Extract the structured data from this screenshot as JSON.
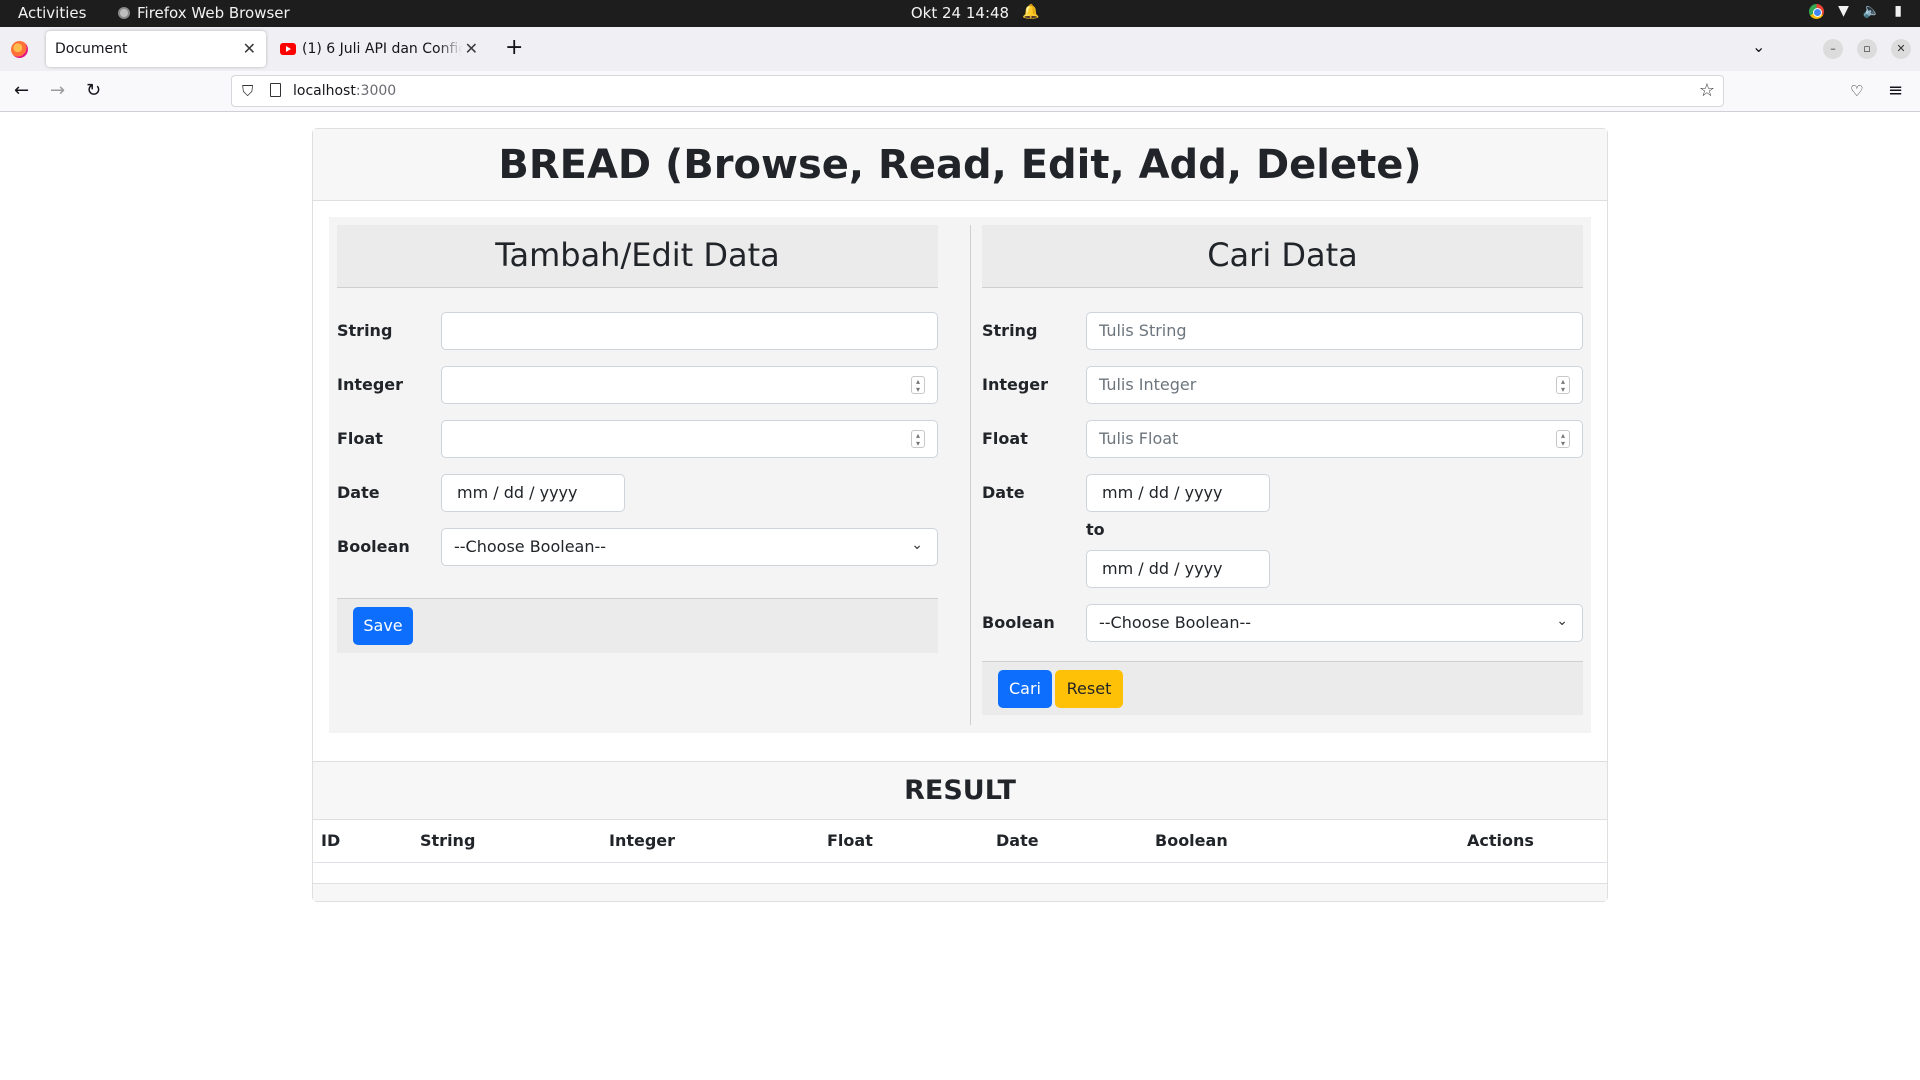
{
  "system": {
    "activities": "Activities",
    "app_name": "Firefox Web Browser",
    "clock": "Okt 24  14:48"
  },
  "browser": {
    "tabs": [
      {
        "title": "Document",
        "active": true
      },
      {
        "title": "(1) 6 Juli API dan Configuration",
        "active": false
      }
    ],
    "url_host": "localhost",
    "url_port": ":3000"
  },
  "page": {
    "title": "BREAD (Browse, Read, Edit, Add, Delete)",
    "add_edit": {
      "heading": "Tambah/Edit Data",
      "string_label": "String",
      "integer_label": "Integer",
      "float_label": "Float",
      "date_label": "Date",
      "date_value": "mm / dd / yyyy",
      "boolean_label": "Boolean",
      "boolean_selected": "--Choose Boolean--",
      "save_label": "Save"
    },
    "search": {
      "heading": "Cari Data",
      "string_label": "String",
      "string_placeholder": "Tulis String",
      "integer_label": "Integer",
      "integer_placeholder": "Tulis Integer",
      "float_label": "Float",
      "float_placeholder": "Tulis Float",
      "date_label": "Date",
      "date_from": "mm / dd / yyyy",
      "to_label": "to",
      "date_to": "mm / dd / yyyy",
      "boolean_label": "Boolean",
      "boolean_selected": "--Choose Boolean--",
      "search_label": "Cari",
      "reset_label": "Reset"
    },
    "result": {
      "heading": "RESULT",
      "columns": [
        "ID",
        "String",
        "Integer",
        "Float",
        "Date",
        "Boolean",
        "Actions"
      ],
      "rows": []
    }
  },
  "colors": {
    "primary": "#0d6efd",
    "warning": "#ffc107",
    "panel_bg": "#f4f4f4"
  }
}
